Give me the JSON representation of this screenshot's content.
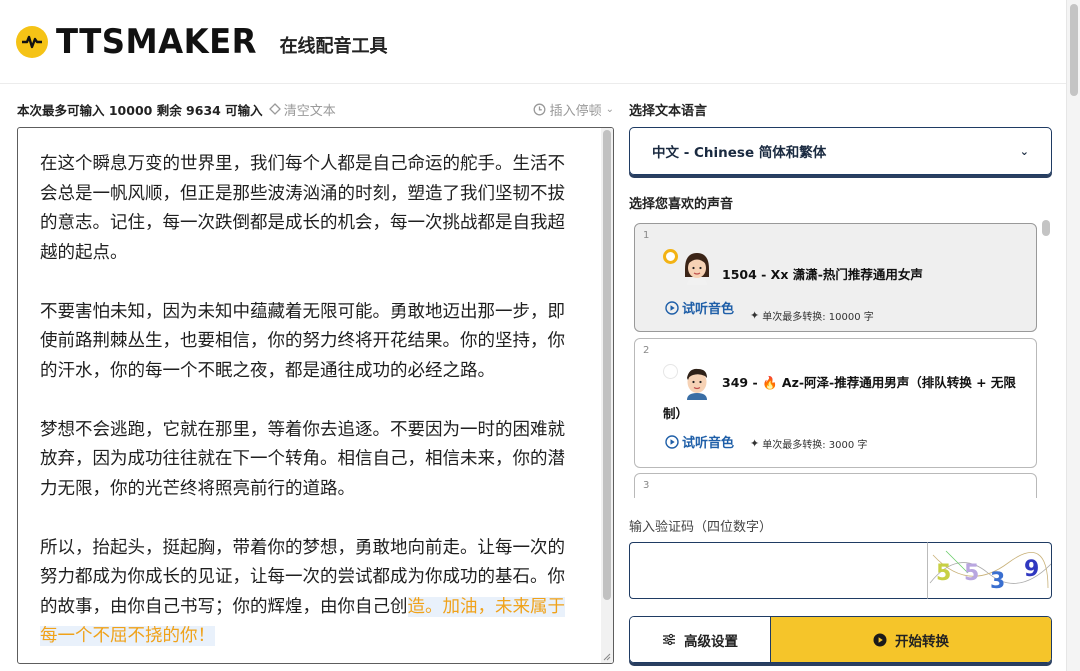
{
  "header": {
    "logo_text": "TTSMAKER",
    "subtitle": "在线配音工具"
  },
  "editor": {
    "count_text": "本次最多可输入 10000 剩余 9634 可输入",
    "clear_label": "清空文本",
    "pause_label": "插入停顿",
    "paragraphs": [
      "在这个瞬息万变的世界里，我们每个人都是自己命运的舵手。生活不会总是一帆风顺，但正是那些波涛汹涌的时刻，塑造了我们坚韧不拔的意志。记住，每一次跌倒都是成长的机会，每一次挑战都是自我超越的起点。",
      "不要害怕未知，因为未知中蕴藏着无限可能。勇敢地迈出那一步，即使前路荆棘丛生，也要相信，你的努力终将开花结果。你的坚持，你的汗水，你的每一个不眠之夜，都是通往成功的必经之路。",
      "梦想不会逃跑，它就在那里，等着你去追逐。不要因为一时的困难就放弃，因为成功往往就在下一个转角。相信自己，相信未来，你的潜力无限，你的光芒终将照亮前行的道路。",
      "所以，抬起头，挺起胸，带着你的梦想，勇敢地向前走。让每一次的努力都成为你成长的见证，让每一次的尝试都成为你成功的基石。你的故事，由你自己书写；你的辉煌，由你自己创"
    ],
    "last_highlight": "造。加油，未来属于每一个不屈不挠的你！"
  },
  "language": {
    "label": "选择文本语言",
    "selected": "中文 - Chinese 简体和繁体"
  },
  "voices": {
    "label": "选择您喜欢的声音",
    "items": [
      {
        "num": "1",
        "name": "1504 - Xx 潇潇-热门推荐通用女声",
        "listen": "试听音色",
        "limit": "单次最多转换: 10000 字",
        "selected": true
      },
      {
        "num": "2",
        "name_line1": "349 - 🔥 Az-阿泽-推荐通用男声（排队转换 + 无限",
        "name_line2": "制）",
        "listen": "试听音色",
        "limit": "单次最多转换: 3000 字",
        "selected": false
      },
      {
        "num": "3"
      }
    ]
  },
  "captcha": {
    "label": "输入验证码（四位数字）",
    "value": "",
    "image_digits": "5539"
  },
  "buttons": {
    "advanced": "高级设置",
    "start": "开始转换"
  },
  "colors": {
    "accent_yellow": "#f5c52a",
    "border_navy": "#1f3b63",
    "link_blue": "#1f5fa8",
    "highlight_orange": "#f0a21a"
  }
}
